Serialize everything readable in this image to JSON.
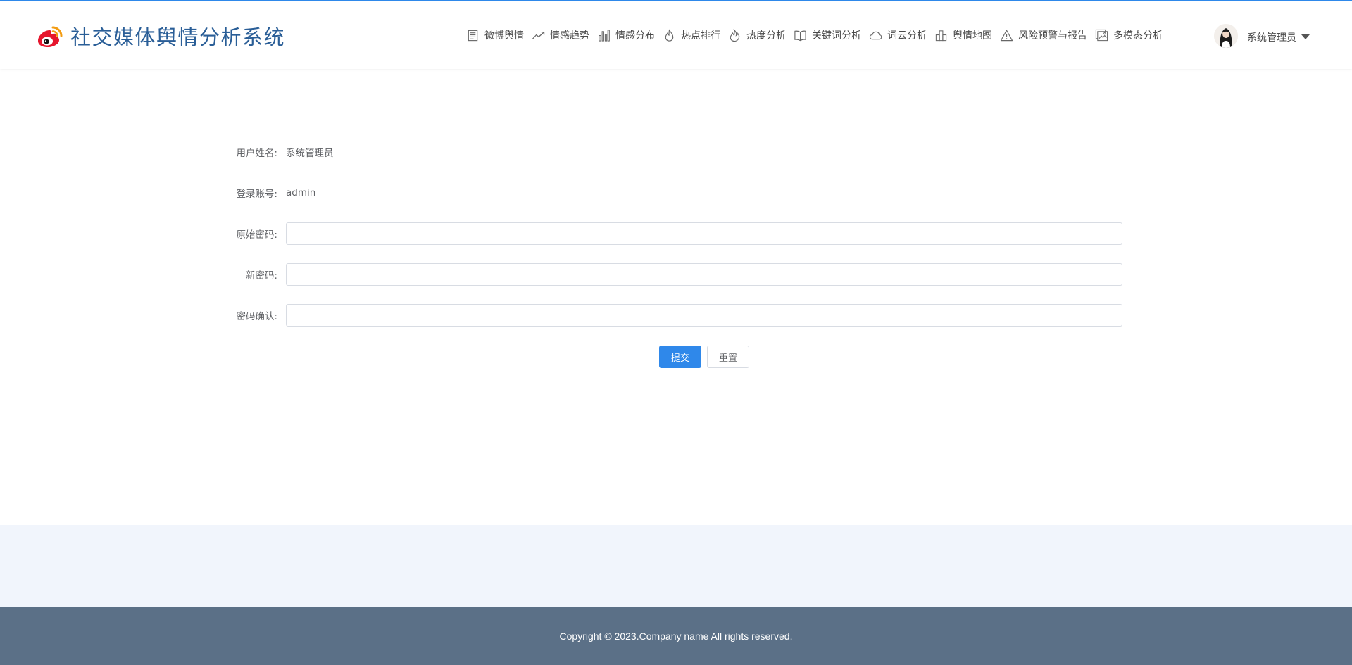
{
  "brand": {
    "title": "社交媒体舆情分析系统",
    "logo_icon": "weibo-logo-icon",
    "accent": "#e6162d"
  },
  "nav": {
    "items": [
      {
        "label": "微博舆情",
        "icon": "document-list-icon"
      },
      {
        "label": "情感趋势",
        "icon": "trend-line-icon"
      },
      {
        "label": "情感分布",
        "icon": "bar-chart-icon"
      },
      {
        "label": "热点排行",
        "icon": "flame-icon"
      },
      {
        "label": "热度分析",
        "icon": "fire-icon"
      },
      {
        "label": "关键词分析",
        "icon": "open-book-icon"
      },
      {
        "label": "词云分析",
        "icon": "cloud-icon"
      },
      {
        "label": "舆情地图",
        "icon": "buildings-icon"
      },
      {
        "label": "风险预警与报告",
        "icon": "warning-triangle-icon"
      },
      {
        "label": "多模态分析",
        "icon": "image-gallery-icon"
      }
    ]
  },
  "user": {
    "name": "系统管理员",
    "avatar_icon": "user-avatar"
  },
  "form": {
    "username_label": "用户姓名:",
    "username_value": "系统管理员",
    "account_label": "登录账号:",
    "account_value": "admin",
    "old_password_label": "原始密码:",
    "old_password_value": "",
    "new_password_label": "新密码:",
    "new_password_value": "",
    "confirm_password_label": "密码确认:",
    "confirm_password_value": "",
    "submit_label": "提交",
    "reset_label": "重置"
  },
  "footer": {
    "copyright": "Copyright © 2023.Company name All rights reserved."
  },
  "colors": {
    "primary": "#2f88ea",
    "brand_title": "#2a5e97",
    "footer_bg": "#5b7087",
    "band_bg": "#f1f5fc"
  }
}
